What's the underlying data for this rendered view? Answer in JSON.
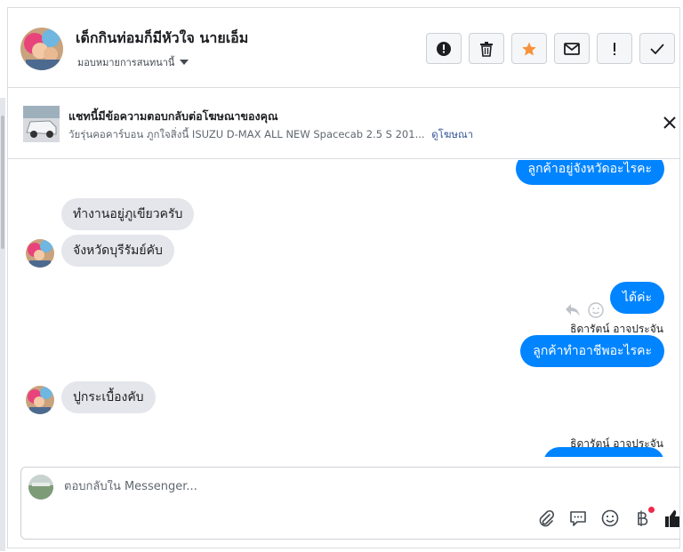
{
  "header": {
    "title": "เด็กกินท่อมก็มีหัวใจ นายเอ็ม",
    "assign_label": "มอบหมายการสนทนานี้",
    "actions": [
      {
        "name": "spam-button",
        "icon": "alert-circle-icon"
      },
      {
        "name": "delete-button",
        "icon": "trash-icon"
      },
      {
        "name": "star-button",
        "icon": "star-icon"
      },
      {
        "name": "mark-unread-button",
        "icon": "envelope-icon"
      },
      {
        "name": "follow-up-button",
        "icon": "exclamation-icon"
      },
      {
        "name": "done-button",
        "icon": "check-icon"
      }
    ],
    "star_color": "#f7923b"
  },
  "ad": {
    "title": "แชทนี้มีข้อความตอบกลับต่อโฆษณาของคุณ",
    "subtitle": "วัยรุ่นคอคาร์บอน ภูกใจสิ่งนี้ ISUZU D-MAX ALL NEW Spacecab 2.5 S 201...",
    "link": "ดูโฆษณา"
  },
  "messages": [
    {
      "side": "out",
      "text": "ลูกค้าอยู่จังหวัดอะไรคะ"
    },
    {
      "side": "in",
      "text": "ทำงานอยู่ภูเขียวครับ"
    },
    {
      "side": "in",
      "text": "จังหวัดบุรีรัมย์คับ"
    },
    {
      "side": "out",
      "text": "ได้ค่ะ"
    },
    {
      "side": "sender",
      "text": "ธิดารัตน์ อาจประจัน"
    },
    {
      "side": "out",
      "text": "ลูกค้าทำอาชีพอะไรคะ"
    },
    {
      "side": "in",
      "text": "ปูกระเบื้องคับ"
    },
    {
      "side": "sender",
      "text": "ธิดารัตน์ อาจประจัน"
    }
  ],
  "composer": {
    "placeholder": "ตอบกลับใน Messenger..."
  },
  "colors": {
    "brand_blue": "#0084ff",
    "incoming_gray": "#e4e6eb",
    "notification_red": "#f02849"
  }
}
